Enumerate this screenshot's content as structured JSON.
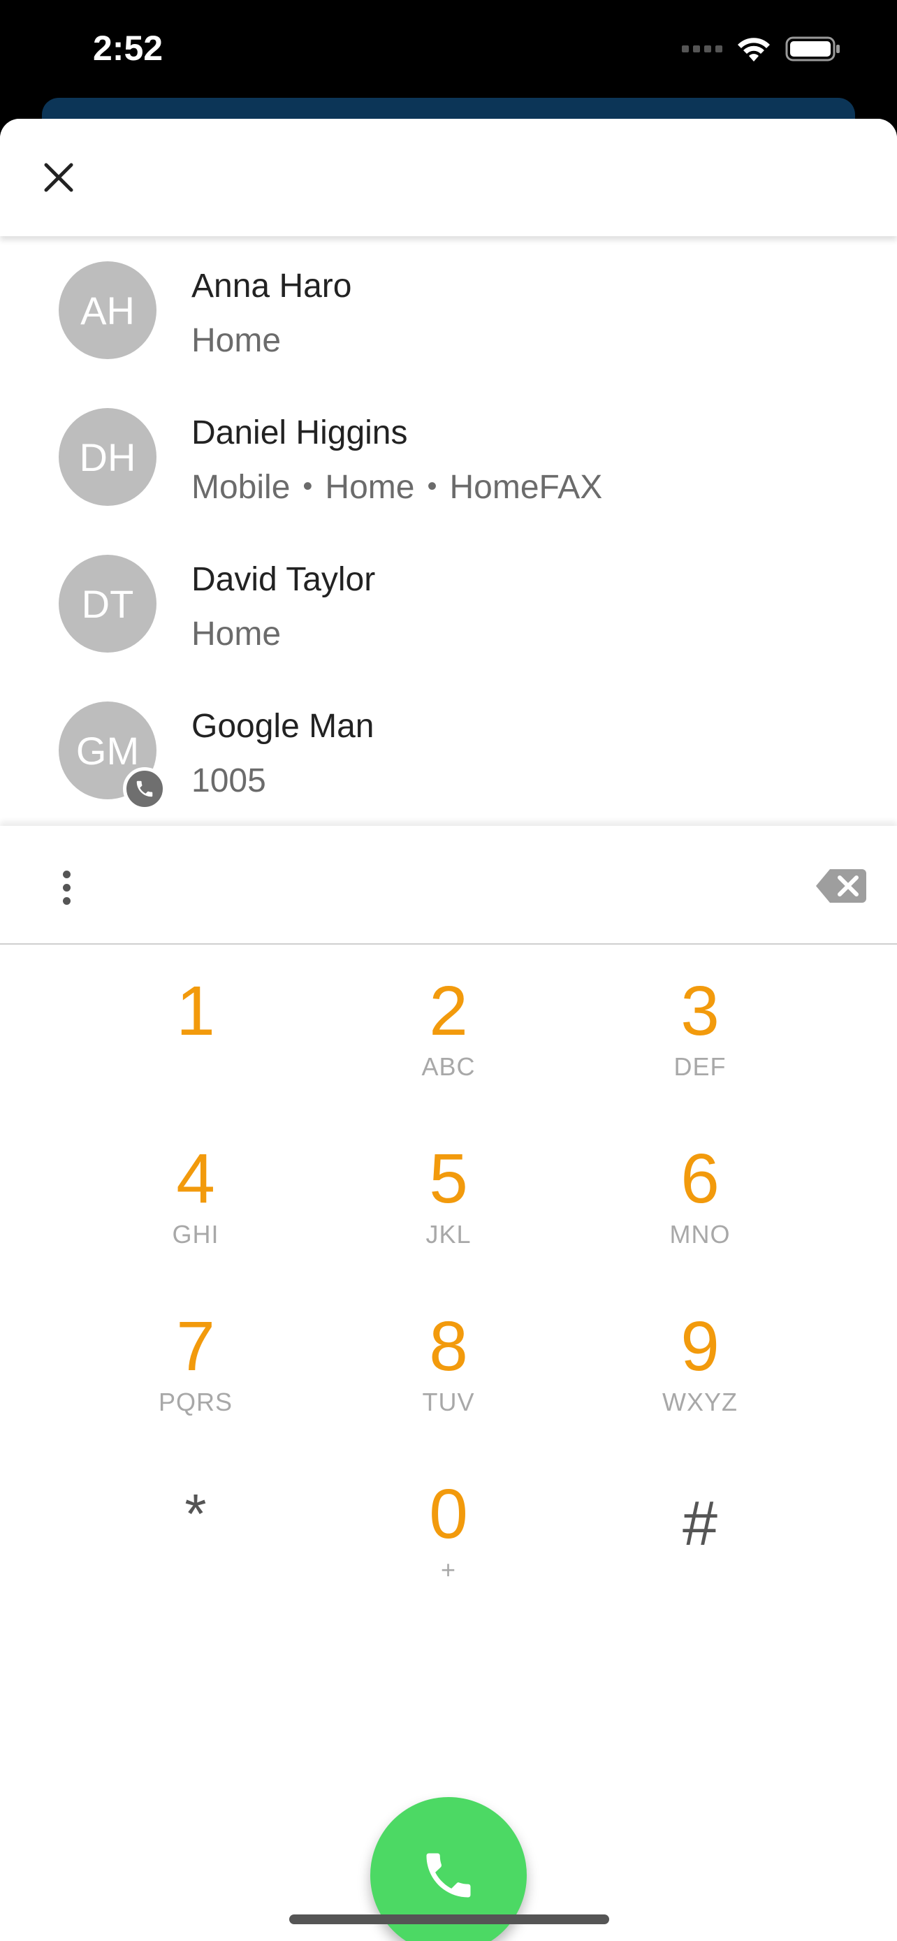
{
  "status_bar": {
    "time": "2:52"
  },
  "contacts": [
    {
      "initials": "AH",
      "name": "Anna Haro",
      "details": [
        "Home"
      ],
      "has_badge": false
    },
    {
      "initials": "DH",
      "name": "Daniel Higgins",
      "details": [
        "Mobile",
        "Home",
        "HomeFAX"
      ],
      "has_badge": false
    },
    {
      "initials": "DT",
      "name": "David Taylor",
      "details": [
        "Home"
      ],
      "has_badge": false
    },
    {
      "initials": "GM",
      "name": "Google Man",
      "details": [
        "1005"
      ],
      "has_badge": true
    }
  ],
  "dialer": {
    "input_value": "",
    "keys": [
      {
        "digit": "1",
        "letters": ""
      },
      {
        "digit": "2",
        "letters": "ABC"
      },
      {
        "digit": "3",
        "letters": "DEF"
      },
      {
        "digit": "4",
        "letters": "GHI"
      },
      {
        "digit": "5",
        "letters": "JKL"
      },
      {
        "digit": "6",
        "letters": "MNO"
      },
      {
        "digit": "7",
        "letters": "PQRS"
      },
      {
        "digit": "8",
        "letters": "TUV"
      },
      {
        "digit": "9",
        "letters": "WXYZ"
      },
      {
        "digit": "*",
        "letters": ""
      },
      {
        "digit": "0",
        "letters": "+"
      },
      {
        "digit": "#",
        "letters": ""
      }
    ]
  },
  "colors": {
    "digit": "#f29a0c",
    "call_button": "#4cd964",
    "avatar": "#bdbdbd",
    "secondary_text": "#6b6b6b"
  },
  "icons": {
    "close": "close-icon",
    "more": "more-vertical-icon",
    "backspace": "backspace-icon",
    "call": "phone-icon",
    "badge": "phone-icon",
    "wifi": "wifi-icon",
    "battery": "battery-icon",
    "signal": "signal-icon"
  }
}
